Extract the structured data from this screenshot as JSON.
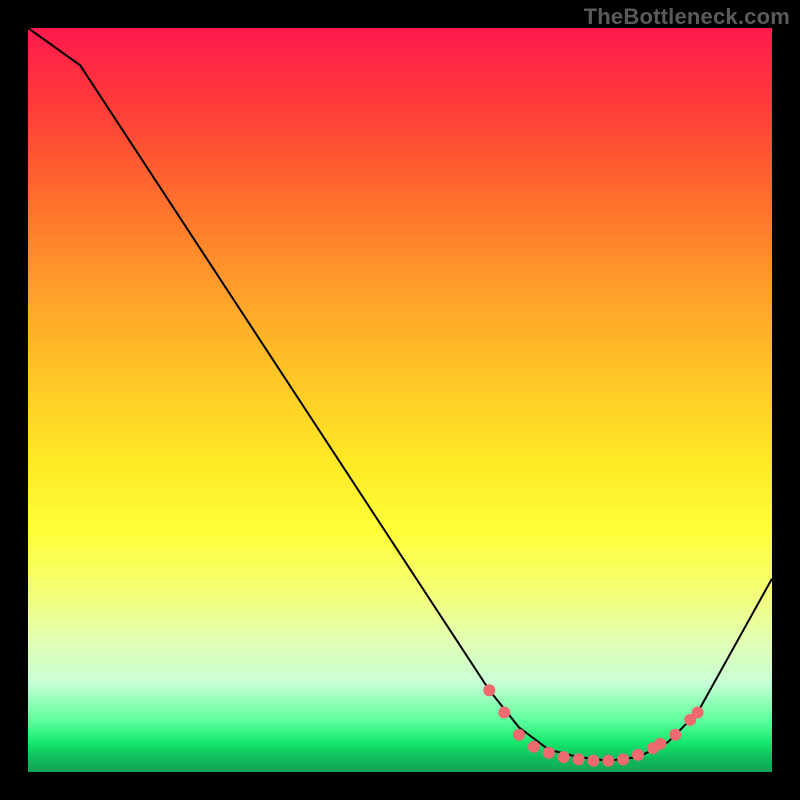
{
  "watermark": "TheBottleneck.com",
  "chart_data": {
    "type": "line",
    "title": "",
    "xlabel": "",
    "ylabel": "",
    "xlim": [
      0,
      100
    ],
    "ylim": [
      0,
      100
    ],
    "grid": false,
    "legend": false,
    "series": [
      {
        "name": "bottleneck-curve",
        "x": [
          0,
          7,
          62,
          66,
          70,
          74,
          78,
          82,
          86,
          90,
          100
        ],
        "y": [
          100,
          95,
          11,
          6,
          3,
          2,
          1.5,
          2,
          4,
          8,
          26
        ]
      }
    ],
    "markers": {
      "name": "highlight-points",
      "points": [
        {
          "x": 62,
          "y": 11
        },
        {
          "x": 64,
          "y": 8
        },
        {
          "x": 66,
          "y": 5
        },
        {
          "x": 68,
          "y": 3.4
        },
        {
          "x": 70,
          "y": 2.6
        },
        {
          "x": 72,
          "y": 2.0
        },
        {
          "x": 74,
          "y": 1.7
        },
        {
          "x": 76,
          "y": 1.5
        },
        {
          "x": 78,
          "y": 1.5
        },
        {
          "x": 80,
          "y": 1.7
        },
        {
          "x": 82,
          "y": 2.3
        },
        {
          "x": 84,
          "y": 3.2
        },
        {
          "x": 85,
          "y": 3.8
        },
        {
          "x": 87,
          "y": 5
        },
        {
          "x": 89,
          "y": 7
        },
        {
          "x": 90,
          "y": 8
        }
      ]
    },
    "gradient_stops": [
      {
        "pos": 0,
        "color": "#ff1a4d"
      },
      {
        "pos": 10,
        "color": "#ff3a3a"
      },
      {
        "pos": 22,
        "color": "#ff6a2d"
      },
      {
        "pos": 34,
        "color": "#ff9a2a"
      },
      {
        "pos": 46,
        "color": "#ffc327"
      },
      {
        "pos": 58,
        "color": "#ffe825"
      },
      {
        "pos": 68,
        "color": "#ffff3a"
      },
      {
        "pos": 75,
        "color": "#f5ff6e"
      },
      {
        "pos": 82,
        "color": "#e3ffb0"
      },
      {
        "pos": 88,
        "color": "#c8ffd8"
      },
      {
        "pos": 93,
        "color": "#5fff9e"
      },
      {
        "pos": 96,
        "color": "#17e86f"
      },
      {
        "pos": 98,
        "color": "#0fbf5d"
      },
      {
        "pos": 100,
        "color": "#12a455"
      }
    ]
  }
}
